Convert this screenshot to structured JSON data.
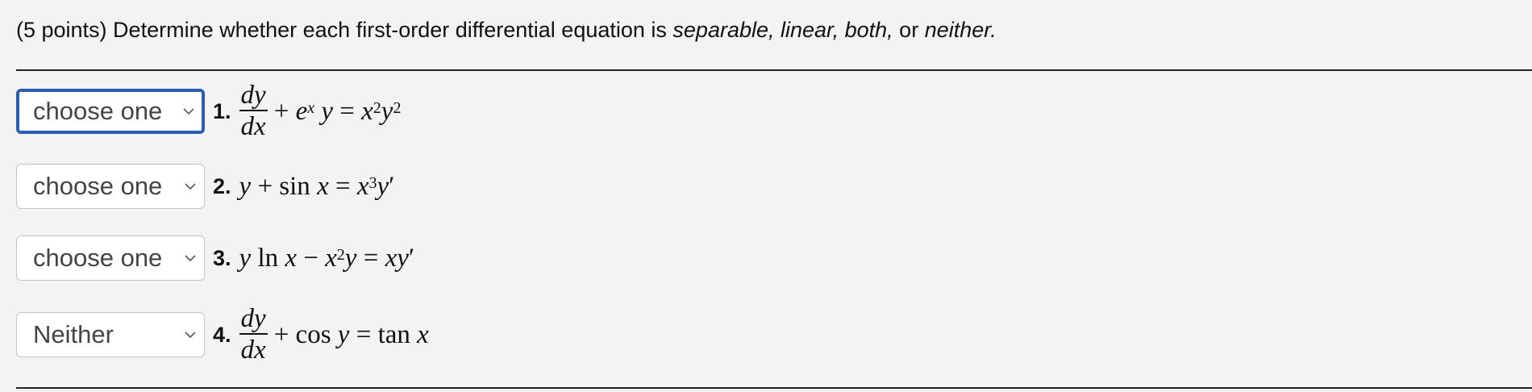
{
  "question": {
    "prefix": "(5 points) Determine whether each first-order differential equation is ",
    "opt_separable": "separable,",
    "opt_linear": "linear,",
    "opt_both": "both,",
    "or_word": "or",
    "opt_neither": "neither."
  },
  "items": [
    {
      "number": "1.",
      "selected": "choose one"
    },
    {
      "number": "2.",
      "selected": "choose one"
    },
    {
      "number": "3.",
      "selected": "choose one"
    },
    {
      "number": "4.",
      "selected": "Neither"
    }
  ],
  "icons": {
    "dropdown": "chevron-down-icon"
  }
}
